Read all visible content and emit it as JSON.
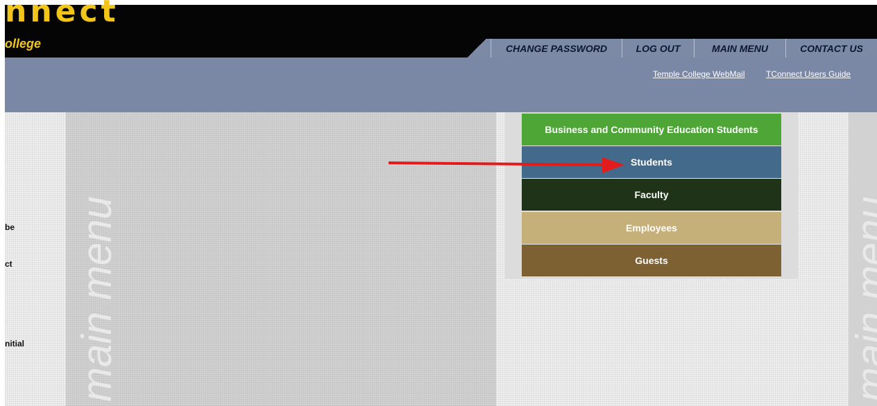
{
  "header": {
    "logo_text": "nnect",
    "logo_sub": "ollege",
    "nav": [
      "CHANGE PASSWORD",
      "LOG OUT",
      "MAIN MENU",
      "CONTACT US"
    ]
  },
  "links": [
    "Temple College WebMail",
    "TConnect Users Guide"
  ],
  "watermark": "main menu",
  "left_text": [
    "be",
    "ct",
    "nitial"
  ],
  "menu": {
    "items": [
      {
        "label": "Business and Community Education Students",
        "color": "#4da636"
      },
      {
        "label": "Students",
        "color": "#436a8a"
      },
      {
        "label": "Faculty",
        "color": "#1f3318"
      },
      {
        "label": "Employees",
        "color": "#c6b07a"
      },
      {
        "label": "Guests",
        "color": "#7d6133"
      }
    ]
  },
  "annotation": {
    "arrow_color": "#e21c1c"
  }
}
